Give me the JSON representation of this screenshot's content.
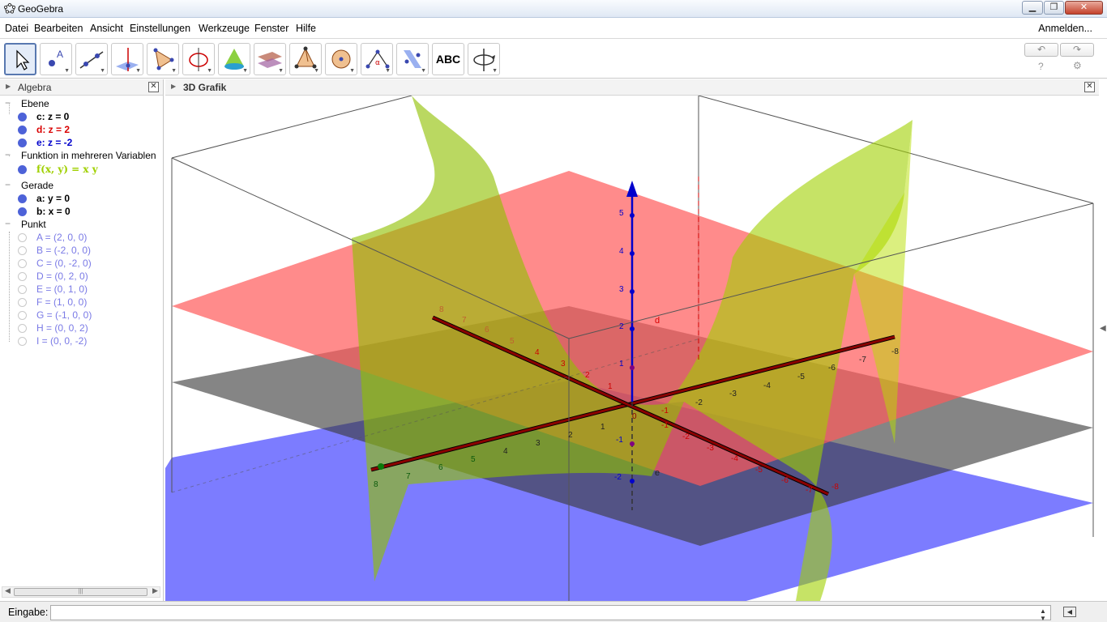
{
  "window": {
    "title": "GeoGebra"
  },
  "menu": {
    "items": [
      "Datei",
      "Bearbeiten",
      "Ansicht",
      "Einstellungen",
      "Werkzeuge",
      "Fenster",
      "Hilfe"
    ],
    "login": "Anmelden..."
  },
  "toolbar": {
    "text_tool_label": "ABC",
    "tools": [
      "move-tool",
      "point-tool",
      "line-tool",
      "perpendicular-line-tool",
      "polygon-tool",
      "circle-axis-tool",
      "pyramid-cone-tool",
      "plane-tool",
      "prism-tool",
      "sphere-tool",
      "angle-tool",
      "reflect-plane-tool",
      "text-tool",
      "rotate-view-tool"
    ]
  },
  "algebra": {
    "header": "Algebra",
    "categories": [
      {
        "label": "Ebene",
        "items": [
          {
            "text": "c: z = 0",
            "color": "#000000",
            "bold": true,
            "visible": true
          },
          {
            "text": "d: z = 2",
            "color": "#d90000",
            "bold": true,
            "visible": true
          },
          {
            "text": "e: z = -2",
            "color": "#0000cc",
            "bold": true,
            "visible": true
          }
        ]
      },
      {
        "label": "Funktion in mehreren Variablen",
        "items": [
          {
            "text": "f(x, y)  =  x y",
            "color": "#a0d000",
            "bold": true,
            "visible": true
          }
        ]
      },
      {
        "label": "Gerade",
        "items": [
          {
            "text": "a: y = 0",
            "color": "#000000",
            "bold": true,
            "visible": true
          },
          {
            "text": "b: x = 0",
            "color": "#000000",
            "bold": true,
            "visible": true
          }
        ]
      },
      {
        "label": "Punkt",
        "items": [
          {
            "text": "A = (2, 0, 0)",
            "color": "#7a7ae6",
            "bold": false,
            "visible": false
          },
          {
            "text": "B = (-2, 0, 0)",
            "color": "#7a7ae6",
            "bold": false,
            "visible": false
          },
          {
            "text": "C = (0, -2, 0)",
            "color": "#7a7ae6",
            "bold": false,
            "visible": false
          },
          {
            "text": "D = (0, 2, 0)",
            "color": "#7a7ae6",
            "bold": false,
            "visible": false
          },
          {
            "text": "E = (0, 1, 0)",
            "color": "#7a7ae6",
            "bold": false,
            "visible": false
          },
          {
            "text": "F = (1, 0, 0)",
            "color": "#7a7ae6",
            "bold": false,
            "visible": false
          },
          {
            "text": "G = (-1, 0, 0)",
            "color": "#7a7ae6",
            "bold": false,
            "visible": false
          },
          {
            "text": "H = (0, 0, 2)",
            "color": "#7a7ae6",
            "bold": false,
            "visible": false
          },
          {
            "text": "I = (0, 0, -2)",
            "color": "#7a7ae6",
            "bold": false,
            "visible": false
          }
        ]
      }
    ]
  },
  "graphics": {
    "header": "3D Grafik",
    "plane_labels": {
      "d": "d",
      "e": "e"
    },
    "z_ticks": [
      "5",
      "4",
      "3",
      "2",
      "1",
      "0",
      "-1",
      "-2"
    ],
    "x_ticks_left": [
      "8",
      "7",
      "6",
      "5",
      "4",
      "3",
      "2",
      "1"
    ],
    "x_ticks_right": [
      "-1",
      "-2",
      "-3",
      "-4",
      "-5",
      "-6",
      "-7",
      "-8"
    ],
    "y_ticks_back": [
      "8",
      "7",
      "6",
      "5",
      "4",
      "3",
      "2",
      "1"
    ],
    "y_ticks_front": [
      "-1",
      "-2",
      "-3",
      "-4",
      "-5",
      "-6",
      "-7",
      "-8"
    ]
  },
  "input": {
    "label": "Eingabe:",
    "value": "",
    "placeholder": ""
  },
  "colors": {
    "plane_d": "#ff5a5a",
    "plane_c": "#444444",
    "plane_e": "#4a4aff",
    "surface_f": "#9ccc00",
    "axis_z": "#0000cc",
    "axis_dark": "#3a0000",
    "accent": "#5878b0"
  }
}
